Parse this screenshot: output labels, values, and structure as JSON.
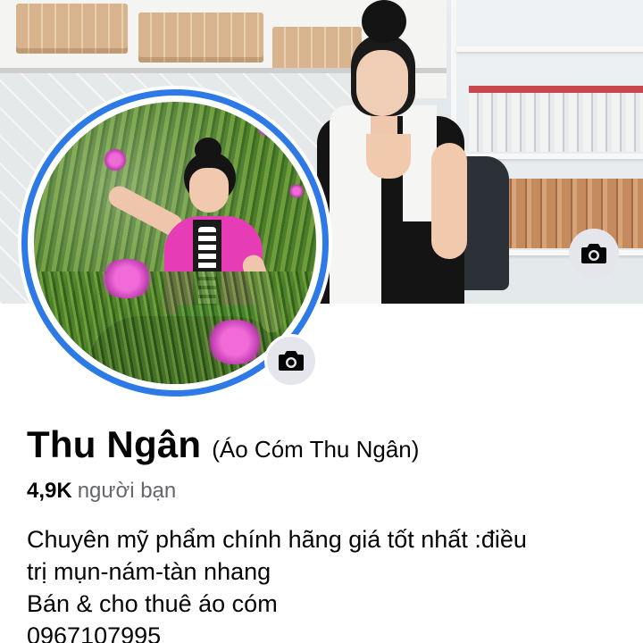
{
  "profile": {
    "name": "Thu Ngân",
    "alternate_name": "(Áo Cóm Thu Ngân)",
    "friends_count": "4,9K",
    "friends_label": "người bạn",
    "bio_lines": [
      "Chuyên mỹ phẩm chính hãng giá tốt nhất :điều",
      "trị mụn-nám-tàn nhang",
      "Bán & cho thuê áo cóm",
      "0967107995"
    ]
  },
  "icons": {
    "cover_camera": "camera-icon",
    "avatar_camera": "camera-icon"
  },
  "colors": {
    "avatar_ring": "#2d79e6",
    "camera_button_bg": "#e4e6eb",
    "secondary_text": "#65676b"
  }
}
